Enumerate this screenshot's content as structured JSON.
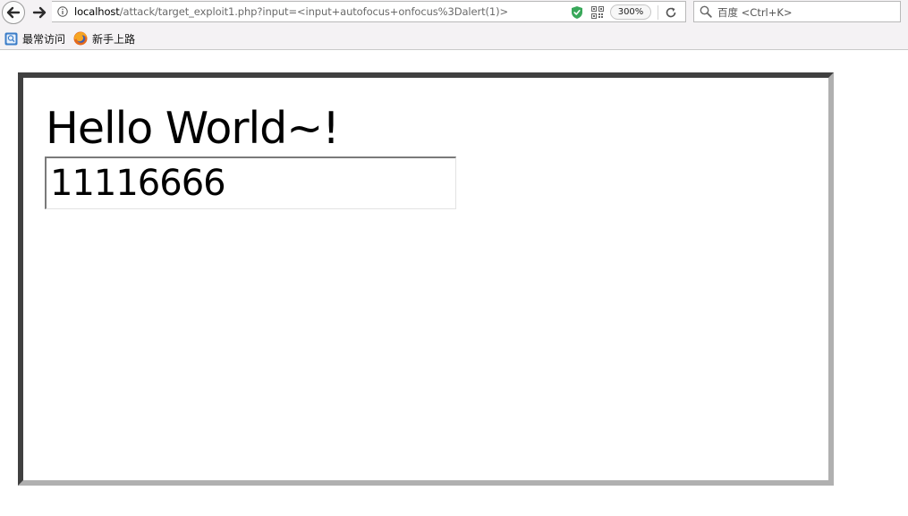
{
  "browser": {
    "url": {
      "host": "localhost",
      "path": "/attack/target_exploit1.php?input=<input+autofocus+onfocus%3Dalert(1)>"
    },
    "zoom": "300%",
    "search": {
      "placeholder": "百度 <Ctrl+K>"
    },
    "bookmarks": [
      {
        "label": "最常访问",
        "icon": "bookmark-folder-icon"
      },
      {
        "label": "新手上路",
        "icon": "firefox-icon"
      }
    ]
  },
  "page": {
    "greeting": "Hello World~!",
    "input_value": "11116666"
  },
  "colors": {
    "toolbar_bg": "#f4f2f4",
    "shield_green": "#39a85a",
    "frame_dark": "#404040",
    "frame_light": "#b0b0b0"
  }
}
